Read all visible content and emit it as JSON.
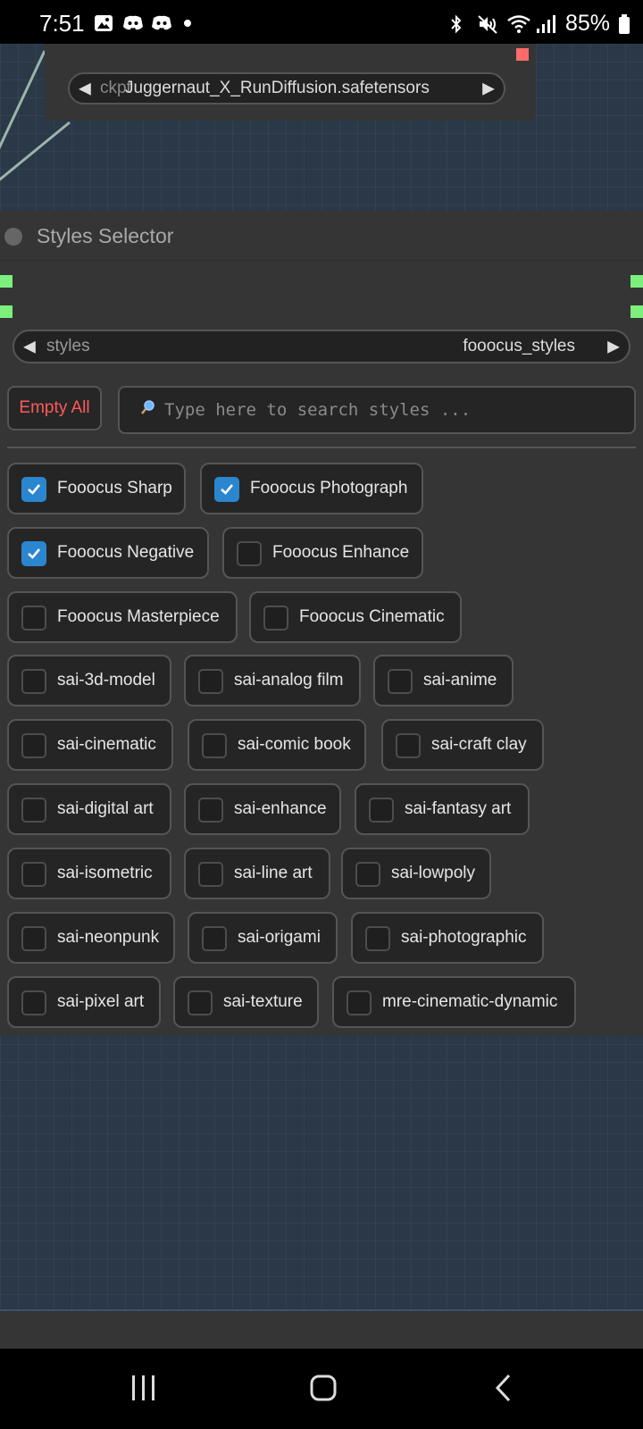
{
  "status_bar": {
    "time": "7:51",
    "battery": "85%",
    "left_icons": [
      "gallery-icon",
      "discord-icon",
      "discord-icon",
      "dot-icon"
    ],
    "right_icons": [
      "bluetooth-icon",
      "mute-icon",
      "wifi-icon",
      "signal-icon",
      "battery-icon"
    ]
  },
  "checkpoint_node": {
    "combo_name": "ckpt",
    "combo_value": "Juggernaut_X_RunDiffusion.safetensors"
  },
  "styles_node": {
    "title": "Styles Selector",
    "combo_label": "styles",
    "combo_value": "fooocus_styles",
    "empty_all_label": "Empty All",
    "search_placeholder": "Type here to search styles ...",
    "styles": [
      {
        "label": "Fooocus Sharp",
        "checked": true
      },
      {
        "label": "Fooocus Photograph",
        "checked": true
      },
      {
        "label": "Fooocus Negative",
        "checked": true
      },
      {
        "label": "Fooocus Enhance",
        "checked": false
      },
      {
        "label": "Fooocus Masterpiece",
        "checked": false
      },
      {
        "label": "Fooocus Cinematic",
        "checked": false
      },
      {
        "label": "sai-3d-model",
        "checked": false
      },
      {
        "label": "sai-analog film",
        "checked": false
      },
      {
        "label": "sai-anime",
        "checked": false
      },
      {
        "label": "sai-cinematic",
        "checked": false
      },
      {
        "label": "sai-comic book",
        "checked": false
      },
      {
        "label": "sai-craft clay",
        "checked": false
      },
      {
        "label": "sai-digital art",
        "checked": false
      },
      {
        "label": "sai-enhance",
        "checked": false
      },
      {
        "label": "sai-fantasy art",
        "checked": false
      },
      {
        "label": "sai-isometric",
        "checked": false
      },
      {
        "label": "sai-line art",
        "checked": false
      },
      {
        "label": "sai-lowpoly",
        "checked": false
      },
      {
        "label": "sai-neonpunk",
        "checked": false
      },
      {
        "label": "sai-origami",
        "checked": false
      },
      {
        "label": "sai-photographic",
        "checked": false
      },
      {
        "label": "sai-pixel art",
        "checked": false
      },
      {
        "label": "sai-texture",
        "checked": false
      },
      {
        "label": "mre-cinematic-dynamic",
        "checked": false
      }
    ]
  },
  "nav_bar": {
    "buttons": [
      "recents-icon",
      "home-icon",
      "back-icon"
    ]
  },
  "colors": {
    "canvas": "#2a3848",
    "node": "#353535",
    "checkbox_checked": "#2b86cf",
    "empty_all_text": "#ff5a5a",
    "slot": "#7cf07c",
    "close_dot": "#ff6b6b"
  }
}
